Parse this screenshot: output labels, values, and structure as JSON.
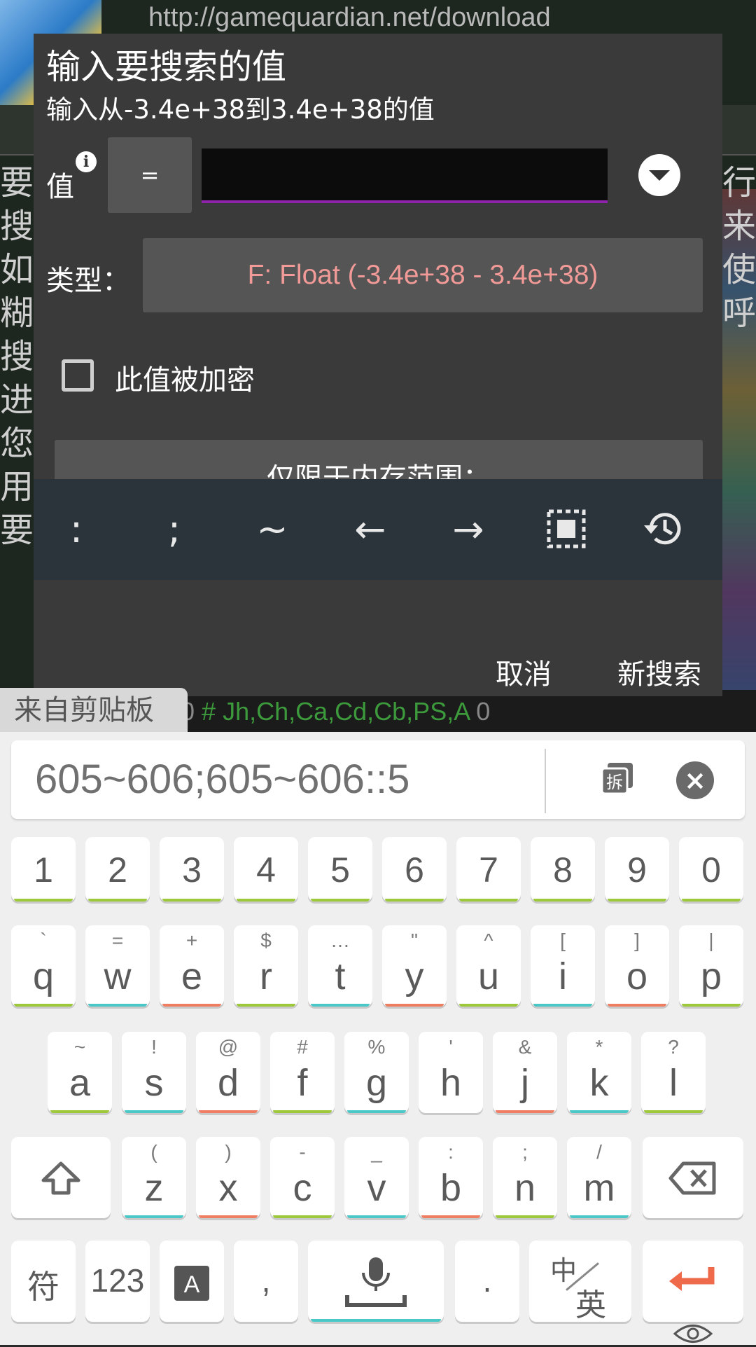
{
  "background": {
    "url_text": "http://gamequardian.net/download",
    "left_chars": [
      "要",
      "搜",
      "如",
      "糊",
      "搜",
      "进",
      "您",
      "用",
      "要"
    ],
    "right_chars": [
      "行",
      "",
      "",
      "",
      "来",
      "",
      "使",
      "",
      "呼"
    ],
    "history_text": "# Jh,Ch,Ca,Cd,Cb,PS,A",
    "history_count": "0",
    "history_prefix": "0"
  },
  "dialog": {
    "title": "输入要搜索的值",
    "subtitle": "输入从-3.4e+38到3.4e+38的值",
    "value_label": "值",
    "info_icon": "i",
    "operator": "=",
    "value_input": "",
    "type_label": "类型：",
    "type_value": "F: Float (-3.4e+38 - 3.4e+38)",
    "encrypted_label": "此值被加密",
    "encrypted_checked": false,
    "range_button": "仅限于内存范围：",
    "special_keys": [
      ":",
      ";",
      "~",
      "←",
      "→",
      "select-all-icon",
      "history-icon"
    ],
    "cancel": "取消",
    "new_search": "新搜索"
  },
  "clipboard": {
    "label": "来自剪贴板",
    "content": "605~606;605~606::5",
    "split_icon": "拆"
  },
  "keyboard": {
    "numbers": [
      "1",
      "2",
      "3",
      "4",
      "5",
      "6",
      "7",
      "8",
      "9",
      "0"
    ],
    "row1": [
      {
        "main": "q",
        "sub": "`"
      },
      {
        "main": "w",
        "sub": "="
      },
      {
        "main": "e",
        "sub": "+"
      },
      {
        "main": "r",
        "sub": "$"
      },
      {
        "main": "t",
        "sub": "…"
      },
      {
        "main": "y",
        "sub": "\""
      },
      {
        "main": "u",
        "sub": "^"
      },
      {
        "main": "i",
        "sub": "["
      },
      {
        "main": "o",
        "sub": "]"
      },
      {
        "main": "p",
        "sub": "|"
      }
    ],
    "row2": [
      {
        "main": "a",
        "sub": "~"
      },
      {
        "main": "s",
        "sub": "!"
      },
      {
        "main": "d",
        "sub": "@"
      },
      {
        "main": "f",
        "sub": "#"
      },
      {
        "main": "g",
        "sub": "%"
      },
      {
        "main": "h",
        "sub": "'"
      },
      {
        "main": "j",
        "sub": "&"
      },
      {
        "main": "k",
        "sub": "*"
      },
      {
        "main": "l",
        "sub": "?"
      }
    ],
    "row3": [
      {
        "main": "z",
        "sub": "("
      },
      {
        "main": "x",
        "sub": ")"
      },
      {
        "main": "c",
        "sub": "-"
      },
      {
        "main": "v",
        "sub": "_"
      },
      {
        "main": "b",
        "sub": ":"
      },
      {
        "main": "n",
        "sub": ";"
      },
      {
        "main": "m",
        "sub": "/"
      }
    ],
    "symbol_key": "符",
    "num_key": "123",
    "comma_key": ",",
    "period_key": ".",
    "lang_key_top": "中",
    "lang_key_bottom": "英"
  },
  "colors": {
    "accent_purple": "#8e24aa",
    "type_text": "#f19a97",
    "enter_orange": "#ee6a4a"
  }
}
